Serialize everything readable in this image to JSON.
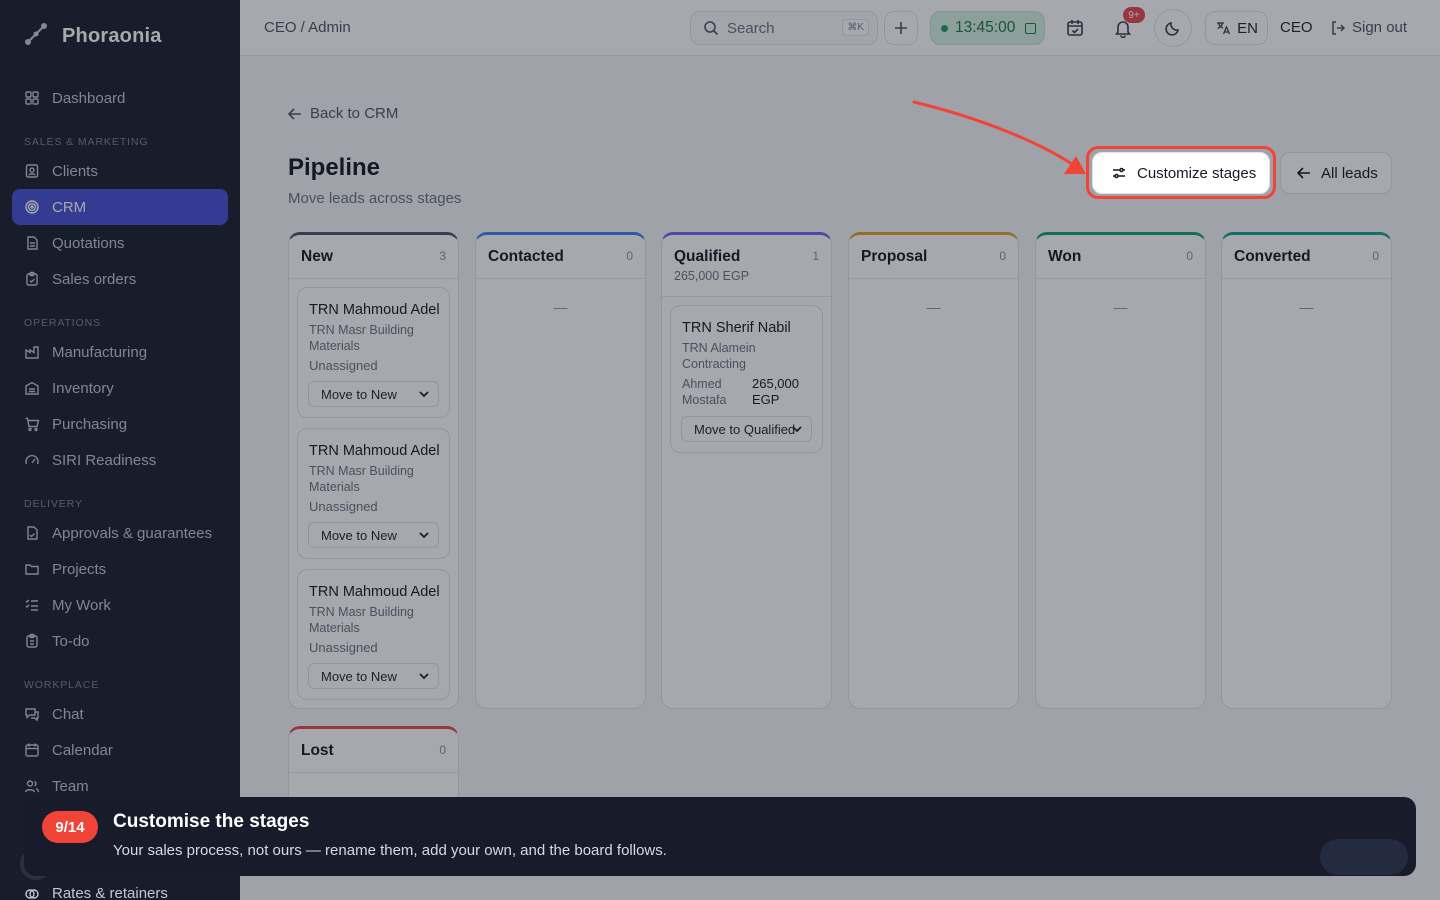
{
  "brand": {
    "name": "Phoraonia"
  },
  "sidebar": {
    "items": [
      {
        "label": "Dashboard",
        "icon": "grid-icon"
      },
      {
        "section": "SALES & MARKETING"
      },
      {
        "label": "Clients",
        "icon": "contact-card-icon"
      },
      {
        "label": "CRM",
        "icon": "target-icon",
        "active": true
      },
      {
        "label": "Quotations",
        "icon": "document-icon"
      },
      {
        "label": "Sales orders",
        "icon": "clipboard-check-icon"
      },
      {
        "section": "OPERATIONS"
      },
      {
        "label": "Manufacturing",
        "icon": "factory-icon"
      },
      {
        "label": "Inventory",
        "icon": "warehouse-icon"
      },
      {
        "label": "Purchasing",
        "icon": "cart-icon"
      },
      {
        "label": "SIRI Readiness",
        "icon": "gauge-icon"
      },
      {
        "section": "DELIVERY"
      },
      {
        "label": "Approvals & guarantees",
        "icon": "file-check-icon"
      },
      {
        "label": "Projects",
        "icon": "folder-icon"
      },
      {
        "label": "My Work",
        "icon": "list-check-icon"
      },
      {
        "label": "To-do",
        "icon": "clipboard-icon"
      },
      {
        "section": "WORKPLACE"
      },
      {
        "label": "Chat",
        "icon": "chat-icon"
      },
      {
        "label": "Calendar",
        "icon": "calendar-icon"
      },
      {
        "label": "Team",
        "icon": "users-icon"
      },
      {
        "label": "Rates & retainers",
        "icon": "money-icon"
      }
    ]
  },
  "topbar": {
    "breadcrumb": "CEO / Admin",
    "search_placeholder": "Search",
    "search_shortcut": "⌘K",
    "clock": "13:45:00",
    "notifications_badge": "9+",
    "language": "EN",
    "role": "CEO",
    "signout_label": "Sign out"
  },
  "page": {
    "back_label": "Back to CRM",
    "title": "Pipeline",
    "subtitle": "Move leads across stages",
    "customize_label": "Customize stages",
    "all_leads_label": "All leads"
  },
  "columns": [
    {
      "title": "New",
      "count": "3",
      "color": "#4b5468",
      "cards": [
        {
          "title": "TRN Mahmoud Adel",
          "company": "TRN Masr Building Materials",
          "owner": "Unassigned",
          "action": "Move to New"
        },
        {
          "title": "TRN Mahmoud Adel",
          "company": "TRN Masr Building Materials",
          "owner": "Unassigned",
          "action": "Move to New"
        },
        {
          "title": "TRN Mahmoud Adel",
          "company": "TRN Masr Building Materials",
          "owner": "Unassigned",
          "action": "Move to New"
        }
      ]
    },
    {
      "title": "Contacted",
      "count": "0",
      "color": "#3b82f6",
      "empty": "—"
    },
    {
      "title": "Qualified",
      "count": "1",
      "color": "#7c5cf2",
      "total": "265,000 EGP",
      "cards": [
        {
          "title": "TRN Sherif Nabil",
          "company": "TRN Alamein Contracting",
          "owner": "Ahmed Mostafa",
          "amount": "265,000 EGP",
          "action": "Move to Qualified"
        }
      ]
    },
    {
      "title": "Proposal",
      "count": "0",
      "color": "#e0a12b",
      "empty": "—"
    },
    {
      "title": "Won",
      "count": "0",
      "color": "#12a46a",
      "empty": "—"
    },
    {
      "title": "Converted",
      "count": "0",
      "color": "#14a38a",
      "empty": "—"
    },
    {
      "title": "Lost",
      "count": "0",
      "color": "#e5484d"
    }
  ],
  "coach": {
    "step": "9/14",
    "title": "Customise the stages",
    "body": "Your sales process, not ours — rename them, add your own, and the board follows."
  },
  "colors": {
    "accent": "#4a50d6",
    "highlight": "#f04438",
    "sidebar_bg": "#1b1f2e"
  }
}
